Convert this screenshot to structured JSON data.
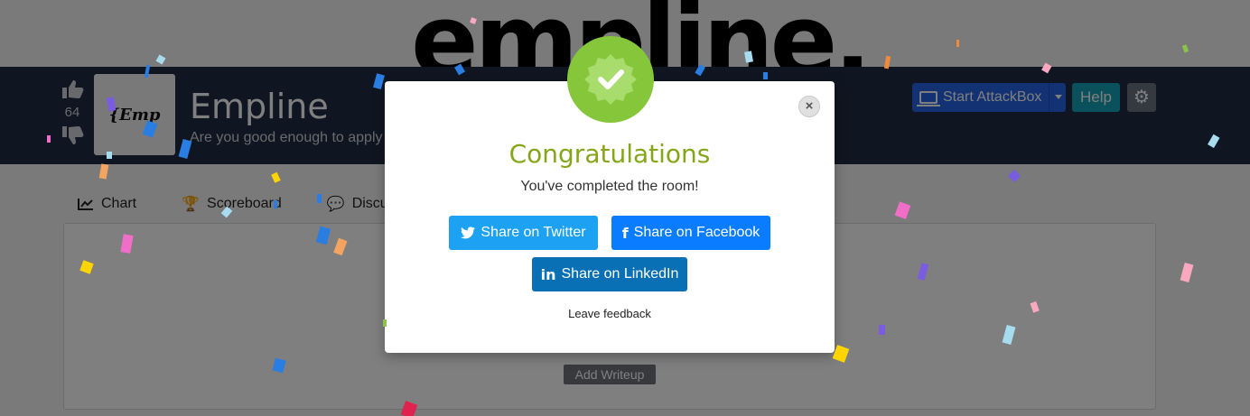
{
  "background": {
    "big_title": "empline.",
    "room": {
      "upvote_count": "64",
      "logo_text": "{Emp",
      "title": "Empline",
      "subtitle": "Are you good enough to apply"
    },
    "header_buttons": {
      "attackbox_label": "Start AttackBox",
      "help_label": "Help"
    },
    "tabs": [
      {
        "label": "Chart",
        "icon": "chart-line-icon"
      },
      {
        "label": "Scoreboard",
        "icon": "trophy-icon"
      },
      {
        "label": "Discu",
        "icon": "comments-icon"
      }
    ],
    "add_writeup_label": "Add Writeup"
  },
  "modal": {
    "title": "Congratulations",
    "message": "You've completed the room!",
    "share_twitter": "Share on Twitter",
    "share_facebook": "Share on Facebook",
    "share_linkedin": "Share on LinkedIn",
    "feedback_link": "Leave feedback",
    "close_symbol": "×",
    "badge_icon": "checkmark-badge-icon"
  },
  "colors": {
    "navy": "#212c42",
    "success_green": "#86c63a",
    "twitter": "#1da1f2",
    "facebook": "#0a7cff",
    "linkedin": "#0a70b5",
    "attackbox_blue": "#2664e8",
    "help_teal": "#17a2b8"
  }
}
